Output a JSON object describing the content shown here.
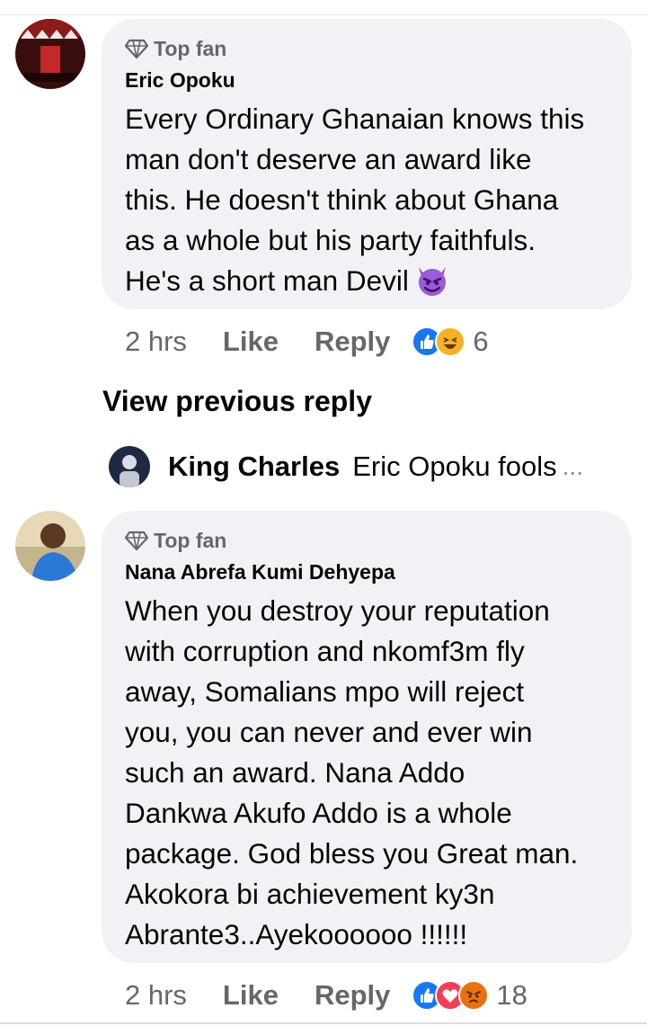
{
  "comments": [
    {
      "badge": "Top fan",
      "author": "Eric Opoku",
      "text": "Every Ordinary Ghanaian knows this\nman don't deserve an award like\nthis. He doesn't think about Ghana\nas a whole but his party faithfuls.\nHe's a short man Devil",
      "time": "2 hrs",
      "like_label": "Like",
      "reply_label": "Reply",
      "reaction_count": "6",
      "reactions": [
        "like-icon",
        "haha-icon"
      ]
    },
    {
      "badge": "Top fan",
      "author": "Nana Abrefa Kumi Dehyepa",
      "text": "When you destroy your reputation\nwith corruption and nkomf3m fly\naway, Somalians mpo will reject\nyou,  you can never and ever win\nsuch an award.  Nana Addo\nDankwa Akufo Addo is a whole\npackage.  God bless you Great man.\n Akokora bi achievement ky3n\nAbrante3..Ayekoooooo !!!!!!",
      "time": "2 hrs",
      "like_label": "Like",
      "reply_label": "Reply",
      "reaction_count": "18",
      "reactions": [
        "like-icon",
        "love-icon",
        "angry-icon"
      ]
    }
  ],
  "view_previous_reply": "View previous reply",
  "reply_preview": {
    "name": "King Charles",
    "text": "Eric Opoku fools",
    "ellipsis": "..."
  },
  "colors": {
    "bubble": "#f0f2f5",
    "secondary_text": "#65676b",
    "like_blue": "#1877f2",
    "love_red": "#f33e58",
    "angry_orange": "#e9710f"
  }
}
